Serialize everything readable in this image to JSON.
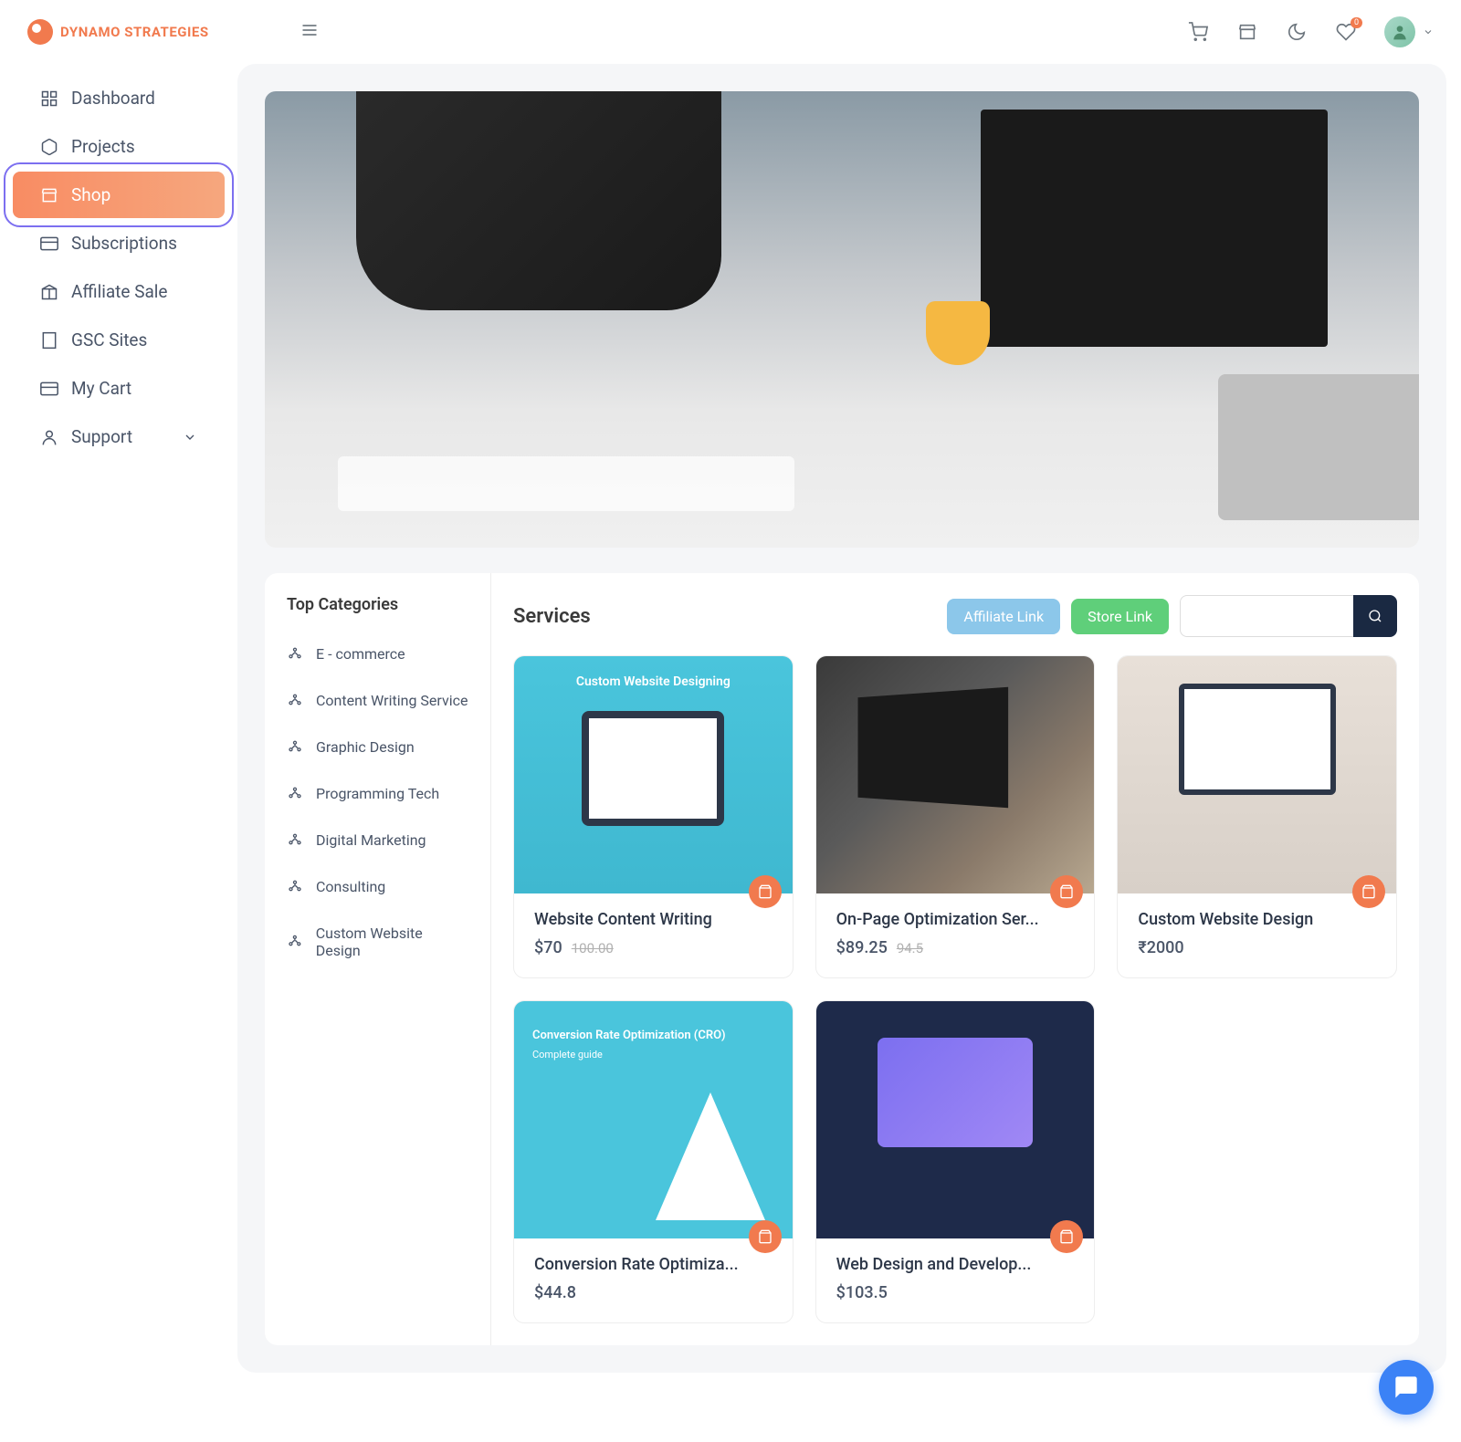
{
  "brand": "DYNAMO STRATEGIES",
  "nav": [
    {
      "label": "Dashboard",
      "icon": "grid"
    },
    {
      "label": "Projects",
      "icon": "box"
    },
    {
      "label": "Shop",
      "icon": "store",
      "active": true
    },
    {
      "label": "Subscriptions",
      "icon": "card"
    },
    {
      "label": "Affiliate Sale",
      "icon": "gift"
    },
    {
      "label": "GSC Sites",
      "icon": "building"
    },
    {
      "label": "My Cart",
      "icon": "card"
    },
    {
      "label": "Support",
      "icon": "user",
      "chevron": true
    }
  ],
  "cart_badge": "0",
  "categories_title": "Top Categories",
  "categories": [
    "E - commerce",
    "Content Writing Service",
    "Graphic Design",
    "Programming Tech",
    "Digital Marketing",
    "Consulting",
    "Custom Website Design"
  ],
  "services_title": "Services",
  "buttons": {
    "affiliate": "Affiliate Link",
    "store": "Store Link"
  },
  "products": [
    {
      "title": "Website Content Writing",
      "price": "$70",
      "old": "100.00",
      "img": "img1"
    },
    {
      "title": "On-Page Optimization Ser...",
      "price": "$89.25",
      "old": "94.5",
      "img": "img2"
    },
    {
      "title": "Custom Website Design",
      "price": "₹2000",
      "old": "",
      "img": "img3"
    },
    {
      "title": "Conversion Rate Optimiza...",
      "price": "$44.8",
      "old": "",
      "img": "img4"
    },
    {
      "title": "Web Design and Develop...",
      "price": "$103.5",
      "old": "",
      "img": "img5"
    }
  ]
}
